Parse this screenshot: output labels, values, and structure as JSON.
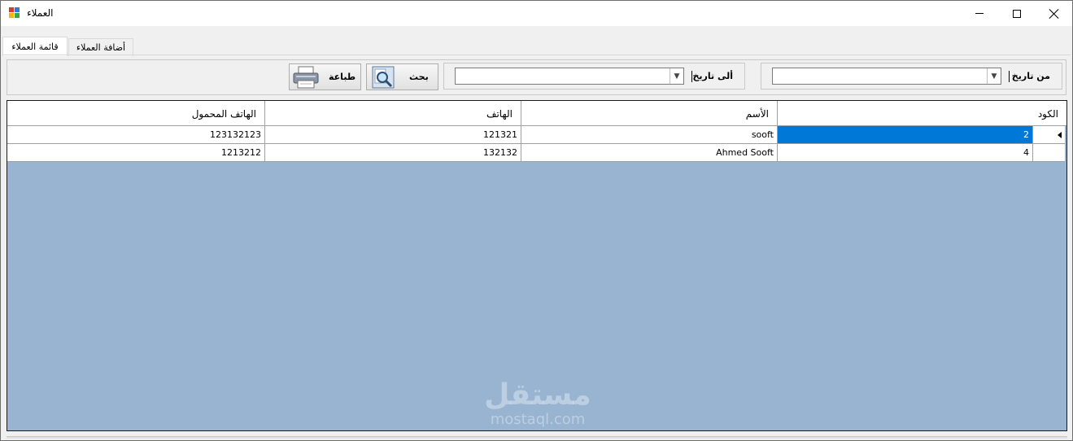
{
  "window": {
    "title": "العملاء",
    "minimize_glyph": "—",
    "maximize_glyph": "☐",
    "close_glyph": "✕",
    "icon": "app-grid-icon"
  },
  "tabs": [
    {
      "label": "قائمة العملاء",
      "active": true
    },
    {
      "label": "أضافة العملاء",
      "active": false
    }
  ],
  "filters": {
    "from_date_label": "من تاريخ",
    "from_date_value": "",
    "to_date_label": "ألى تاريخ",
    "to_date_value": "",
    "search_button_label": "بحث",
    "print_button_label": "طباعة"
  },
  "grid": {
    "columns": [
      "الكود",
      "الأسم",
      "الهاتف",
      "الهاتف المحمول"
    ],
    "rows": [
      {
        "code": "2",
        "name": "sooft",
        "phone": "121321",
        "mobile": "123132123",
        "selected": true
      },
      {
        "code": "4",
        "name": "Ahmed Sooft",
        "phone": "132132",
        "mobile": "1213212",
        "selected": false
      }
    ]
  },
  "watermark": {
    "arabic": "مستقل",
    "latin": "mostaql.com"
  },
  "colors": {
    "grid_background": "#99b4d1",
    "selection": "#0078d7"
  }
}
